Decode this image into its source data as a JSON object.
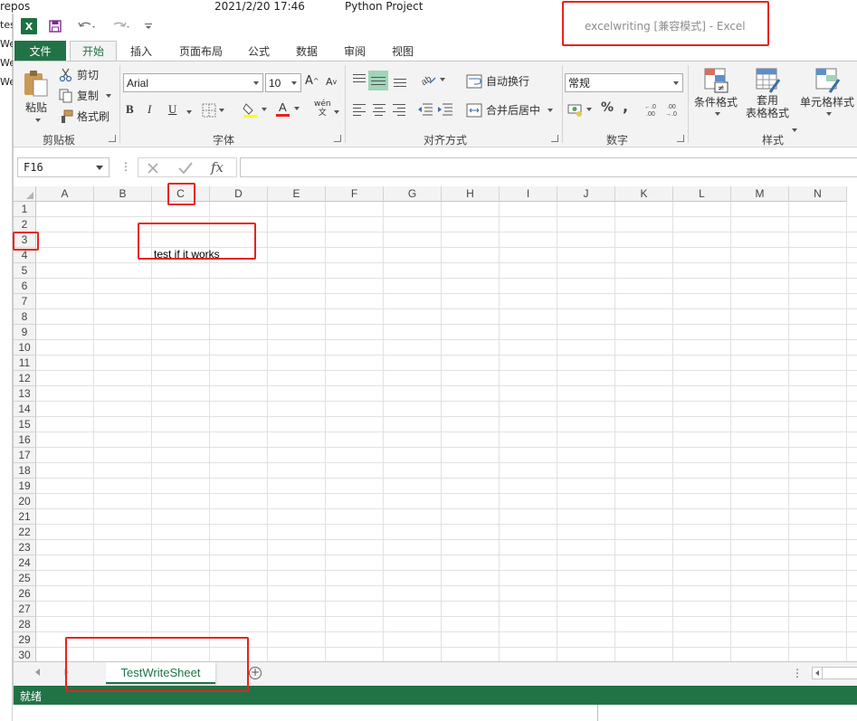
{
  "background": {
    "top_left_text": "repos",
    "timestamp": "2021/2/20 17:46",
    "project": "Python Project",
    "left_fragments": [
      "tes",
      "We",
      "We",
      "We"
    ]
  },
  "window": {
    "title": "excelwriting  [兼容模式] - Excel",
    "app_icon_letter": "X"
  },
  "tabs": [
    "文件",
    "开始",
    "插入",
    "页面布局",
    "公式",
    "数据",
    "审阅",
    "视图"
  ],
  "ribbon": {
    "clipboard": {
      "paste": "粘贴",
      "cut": "剪切",
      "copy": "复制",
      "format_painter": "格式刷",
      "label": "剪贴板"
    },
    "font": {
      "name": "Arial",
      "size": "10",
      "bold": "B",
      "italic": "I",
      "underline": "U",
      "phonetic": "wén",
      "label": "字体"
    },
    "alignment": {
      "wrap_text": "自动换行",
      "merge_center": "合并后居中",
      "label": "对齐方式"
    },
    "number": {
      "format": "常规",
      "percent": "%",
      "comma": ",",
      "label": "数字"
    },
    "styles": {
      "conditional": "条件格式",
      "table_line1": "套用",
      "table_line2": "表格格式",
      "cell_styles": "单元格样式",
      "label": "样式"
    }
  },
  "formula_bar": {
    "name_box": "F16",
    "fx": "fx",
    "value": ""
  },
  "grid": {
    "columns": [
      "A",
      "B",
      "C",
      "D",
      "E",
      "F",
      "G",
      "H",
      "I",
      "J",
      "K",
      "L",
      "M",
      "N"
    ],
    "rows": [
      "1",
      "2",
      "3",
      "4",
      "5",
      "6",
      "7",
      "8",
      "9",
      "10",
      "11",
      "12",
      "13",
      "14",
      "15",
      "16",
      "17",
      "18",
      "19",
      "20",
      "21",
      "22",
      "23",
      "24",
      "25",
      "26",
      "27",
      "28",
      "29",
      "30"
    ],
    "cells": {
      "C3": "test if it works"
    }
  },
  "sheets": {
    "active": "TestWriteSheet"
  },
  "status": {
    "ready": "就绪"
  },
  "colors": {
    "accent": "#217346",
    "highlight": "#e8231b"
  }
}
